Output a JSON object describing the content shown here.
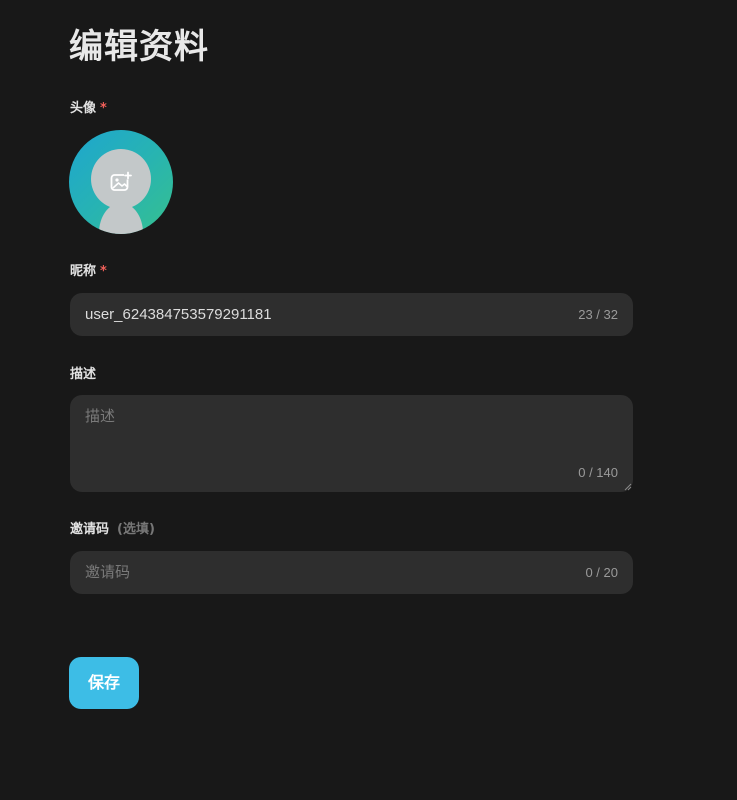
{
  "page": {
    "title": "编辑资料"
  },
  "avatar": {
    "label": "头像",
    "required_mark": "*",
    "icon": "image-add-icon"
  },
  "nickname": {
    "label": "昵称",
    "required_mark": "*",
    "value": "user_624384753579291181",
    "count": "23 / 32"
  },
  "description": {
    "label": "描述",
    "placeholder": "描述",
    "count": "0 / 140"
  },
  "invite_code": {
    "label": "邀请码",
    "optional_note": "(选填)",
    "placeholder": "邀请码",
    "count": "0 / 20"
  },
  "actions": {
    "save_label": "保存"
  },
  "colors": {
    "background": "#181818",
    "field_background": "#2e2e2e",
    "accent": "#3dbde6",
    "required": "#f2605a"
  }
}
